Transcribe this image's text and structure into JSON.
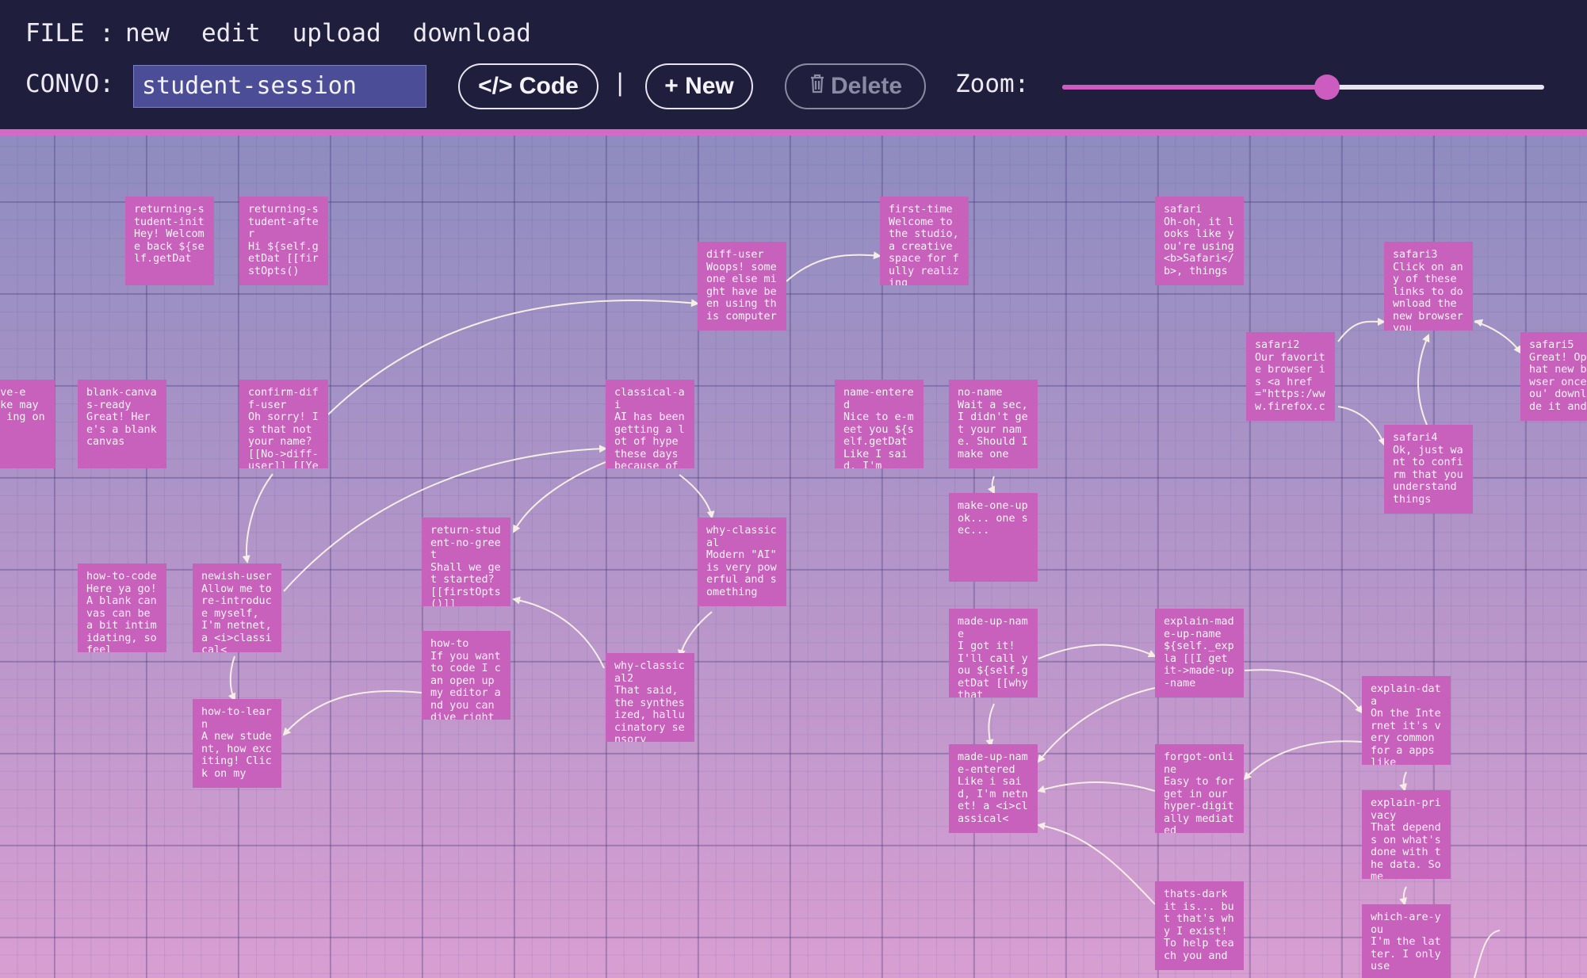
{
  "menu": {
    "label": "FILE :",
    "items": [
      "new",
      "edit",
      "upload",
      "download"
    ]
  },
  "toolbar": {
    "convo_label": "CONVO:",
    "convo_value": "student-session",
    "code_label": "</> Code",
    "separator": "|",
    "new_label": "+ New",
    "delete_label": "Delete",
    "zoom_label": "Zoom:",
    "zoom_level": 0.55
  },
  "colors": {
    "accent": "#cc5cc0",
    "node": "#c861bc",
    "background": "#1f1f3d"
  },
  "nodes": [
    {
      "name": "returning-student-init",
      "text": "Hey! Welcome back ${self.getDat"
    },
    {
      "name": "returning-student-after",
      "text": "Hi ${self.getDat [[firstOpts()"
    },
    {
      "name": "diff-user",
      "text": "Woops! someone else might have been using this computer"
    },
    {
      "name": "first-time",
      "text": "Welcome to the studio, a creative space for fully realizing"
    },
    {
      "name": "safari",
      "text": "Oh-oh, it looks like you're using <b>Safari</b>, things"
    },
    {
      "name": "safari3",
      "text": "Click on any of these links to download the new browser you"
    },
    {
      "name": "safari2",
      "text": "Our favorite browser is <a href=\"https:/www.firefox.c"
    },
    {
      "name": "safari5",
      "text": "Great! Op that new browser once you' downloade it and"
    },
    {
      "name": "r-save-e",
      "text": "s like may been ing on atch"
    },
    {
      "name": "blank-canvas-ready",
      "text": "Great! Here's a blank canvas"
    },
    {
      "name": "confirm-diff-user",
      "text": "Oh sorry! Is that not your name? [[No->diff-user]] [[Ye"
    },
    {
      "name": "classical-ai",
      "text": "AI has been getting a lot of hype these days because of"
    },
    {
      "name": "name-entered",
      "text": "Nice to e-meet you ${self.getDat Like I said, I'm"
    },
    {
      "name": "no-name",
      "text": "Wait a sec, I didn't get your name. Should I make one"
    },
    {
      "name": "safari4",
      "text": "Ok, just want to confirm that you understand things"
    },
    {
      "name": "make-one-up",
      "text": "ok... one sec..."
    },
    {
      "name": "return-student-no-greet",
      "text": "Shall we get started? [[firstOpts()]]"
    },
    {
      "name": "why-classical",
      "text": "Modern \"AI\" is very powerful and something"
    },
    {
      "name": "how-to-code",
      "text": "Here ya go! A blank canvas can be a bit intimidating, so feel"
    },
    {
      "name": "newish-user",
      "text": "Allow me to re-introduce myself, I'm netnet, a <i>classical<"
    },
    {
      "name": "how-to",
      "text": "If you want to code I can open up my editor and you can dive right"
    },
    {
      "name": "made-up-name",
      "text": "I got it! I'll call you ${self.getDat [[why that"
    },
    {
      "name": "explain-made-up-name",
      "text": "${self._expla [[I get it->made-up-name"
    },
    {
      "name": "why-classical2",
      "text": "That said, the synthesized, hallucinatory sensory"
    },
    {
      "name": "explain-data",
      "text": "On the Internet it's very common for a apps like"
    },
    {
      "name": "how-to-learn",
      "text": "A new student, how exciting! Click on my"
    },
    {
      "name": "made-up-name-entered",
      "text": "Like i said, I'm netnet! a <i>classical<"
    },
    {
      "name": "forgot-online",
      "text": "Easy to forget in our hyper-digitally mediated"
    },
    {
      "name": "explain-privacy",
      "text": "That depends on what's done with the data. Some"
    },
    {
      "name": "thats-dark",
      "text": "it is... but that's why I exist! To help teach you and"
    },
    {
      "name": "which-are-you",
      "text": "I'm the latter. I only use"
    }
  ]
}
